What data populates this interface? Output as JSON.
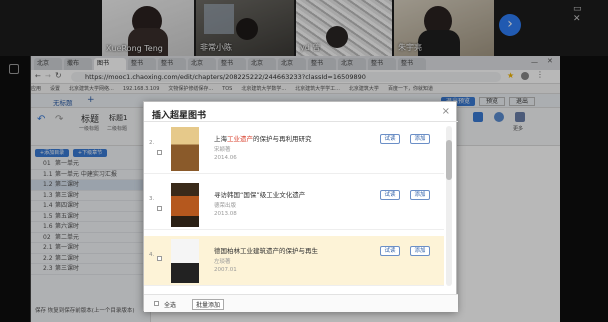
{
  "meeting": {
    "participants": [
      {
        "name": "XueRong Teng"
      },
      {
        "name": "非常小陈"
      },
      {
        "name": "yd 曾"
      },
      {
        "name": "朱宇亮"
      }
    ]
  },
  "browser": {
    "tabs": [
      "北京",
      "撒布",
      "图书",
      "整书",
      "整书",
      "北京",
      "整书",
      "北京",
      "北京",
      "整书",
      "北京",
      "整书",
      "整书"
    ],
    "url": "https://mooc1.chaoxing.com/edit/chapters/208225222/244663233?classId=16509890",
    "bookmarks": [
      "应用",
      "设置",
      "北京建筑大学网络...",
      "192.168.3.109",
      "文物保护修缮保存...",
      "TOS",
      "北京建筑大学数学...",
      "北京建筑大学学工...",
      "北京建筑大学",
      "百度一下，你就知道"
    ]
  },
  "editor": {
    "title_link": "无标题",
    "ribbon": {
      "heading": "标题",
      "heading1": "标题1",
      "heading2": "二级标题",
      "subtitle": "一级标题",
      "more": "更多"
    },
    "toolbar_right": [
      "退出预览",
      "预览",
      "退出"
    ],
    "left_buttons": [
      "+添加目录",
      "+下级章节"
    ],
    "chapters": [
      {
        "num": "01",
        "label": "第一单元"
      },
      {
        "num": "1.1",
        "label": "第一单元 中建实习汇报"
      },
      {
        "num": "1.2",
        "label": "第二课时"
      },
      {
        "num": "1.3",
        "label": "第三课时"
      },
      {
        "num": "1.4",
        "label": "第四课时"
      },
      {
        "num": "1.5",
        "label": "第五课时"
      },
      {
        "num": "1.6",
        "label": "第六课时"
      },
      {
        "num": "02",
        "label": "第二单元"
      },
      {
        "num": "2.1",
        "label": "第一课时"
      },
      {
        "num": "2.2",
        "label": "第二课时"
      },
      {
        "num": "2.3",
        "label": "第三课时"
      }
    ],
    "footer_hint": "恢复到保存前版本(上一个目录版本)",
    "save_label": "保存"
  },
  "modal": {
    "title": "插入超星图书",
    "close": "×",
    "books": [
      {
        "index": "2.",
        "title_pre": "上海",
        "title_red": "工业遗产",
        "title_post": "的保护与再利用研究",
        "author": "宋颖著",
        "date": "2014.06",
        "selected": false
      },
      {
        "index": "3.",
        "title_pre": "寻访韩国“国保”级工业文化遗产",
        "title_red": "",
        "title_post": "",
        "author": "德荣出版",
        "date": "2013.08",
        "selected": false
      },
      {
        "index": "4.",
        "title_pre": "德国柏林工业建筑遗产的保护与再生",
        "title_red": "",
        "title_post": "",
        "author": "左琰著",
        "date": "2007.01",
        "selected": true
      }
    ],
    "btn_preview": "试读",
    "btn_add": "添加",
    "select_all": "全选",
    "batch_add": "批量添加"
  },
  "colors": {
    "accent": "#3a7bd5",
    "highlight_row": "#fdf3d7",
    "keyword_red": "#d9412e"
  }
}
